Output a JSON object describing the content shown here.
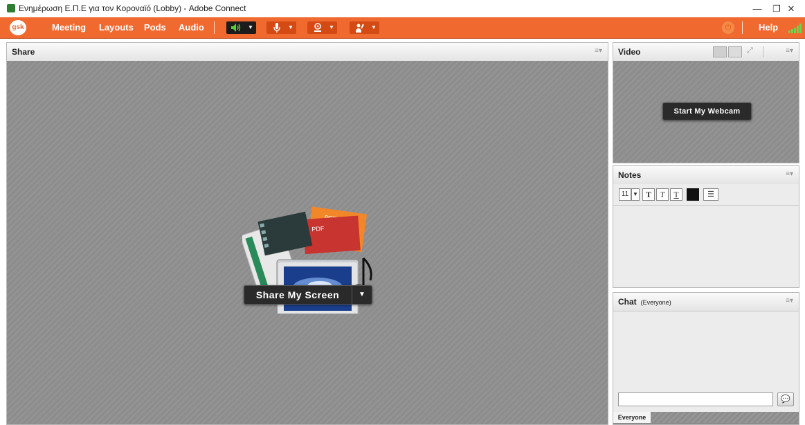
{
  "window": {
    "title": "Ενημέρωση Ε.Π.Ε για τον Κορoναϊό (Lobby) - Adobe Connect",
    "minimize_icon": "—",
    "restore_icon": "❐",
    "close_icon": "✕"
  },
  "menubar": {
    "logo": "gsk",
    "items": [
      "Meeting",
      "Layouts",
      "Pods",
      "Audio"
    ],
    "help": "Help",
    "accent_color": "#f06a30"
  },
  "toolbar": {
    "speaker_icon": "speaker-icon",
    "mic_icon": "microphone-icon",
    "camera_icon": "camera-icon",
    "raise_hand_icon": "raise-hand-icon"
  },
  "share_pod": {
    "title": "Share",
    "share_button": "Share My Screen",
    "doc_labels": [
      "PPT",
      "PDF"
    ]
  },
  "video_pod": {
    "title": "Video",
    "start_button": "Start My Webcam"
  },
  "notes_pod": {
    "title": "Notes",
    "font_size": "11",
    "bold": "T",
    "italic": "T",
    "underline": "T"
  },
  "chat_pod": {
    "title": "Chat",
    "subtitle": "(Everyone)",
    "tab": "Everyone"
  }
}
